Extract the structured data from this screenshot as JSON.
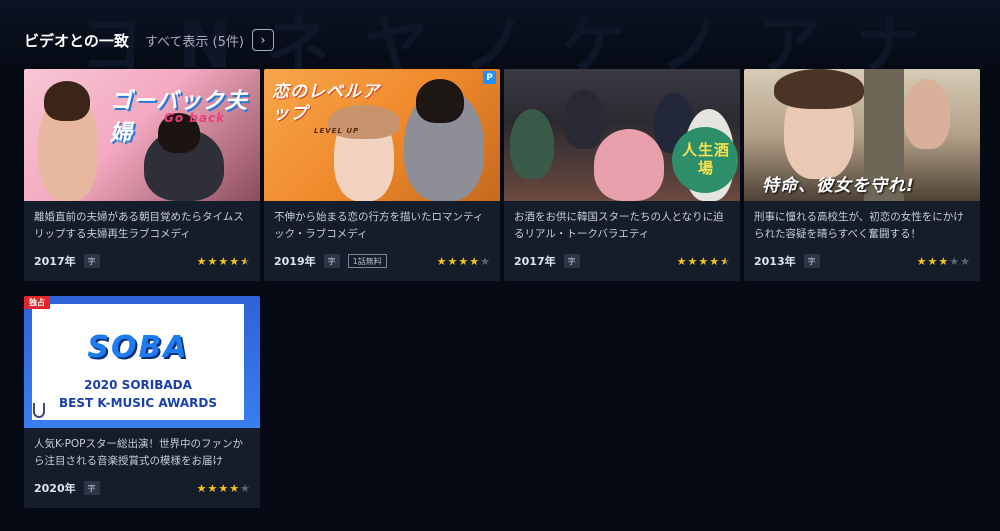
{
  "section": {
    "title": "ビデオとの一致",
    "show_all": "すべて表示 (5件)",
    "arrow_icon": "chevron-right-icon"
  },
  "colors": {
    "background": "#050a14",
    "card": "#151d2b",
    "star_on": "#f3c316",
    "star_off": "#5b6474",
    "exclusive": "#e3262b",
    "premium": "#1e90ff"
  },
  "cards": [
    {
      "art_title": "ゴーバック夫婦",
      "art_subtitle": "Go back",
      "description": "離婚直前の夫婦がある朝目覚めたらタイムスリップする夫婦再生ラブコメディ",
      "year": "2017年",
      "sub_label": "字",
      "rating": 4.5
    },
    {
      "art_title": "恋のレベルアップ",
      "art_subtitle": "LEVEL UP",
      "premium_label": "P",
      "description": "不伸から始まる恋の行方を描いたロマンティック・ラブコメディ",
      "year": "2019年",
      "sub_label": "字",
      "free_label": "1話無料",
      "rating": 4
    },
    {
      "art_title": "人生酒場",
      "description": "お酒をお供に韓国スターたちの人となりに迫るリアル・トークバラエティ",
      "year": "2017年",
      "sub_label": "字",
      "rating": 4.5
    },
    {
      "art_title": "特命、彼女を守れ!",
      "description": "刑事に憧れる高校生が、初恋の女性をにかけられた容疑を晴らすべく奮闘する！",
      "year": "2013年",
      "sub_label": "字",
      "rating": 3
    },
    {
      "exclusive_label": "独占",
      "art_title": "SOBA",
      "art_line1": "2020 SORIBADA",
      "art_line2": "BEST K-MUSIC AWARDS",
      "description": "人気K-POPスター総出演！世界中のファンから注目される音楽授賞式の模様をお届け",
      "year": "2020年",
      "sub_label": "字",
      "rating": 4
    }
  ]
}
